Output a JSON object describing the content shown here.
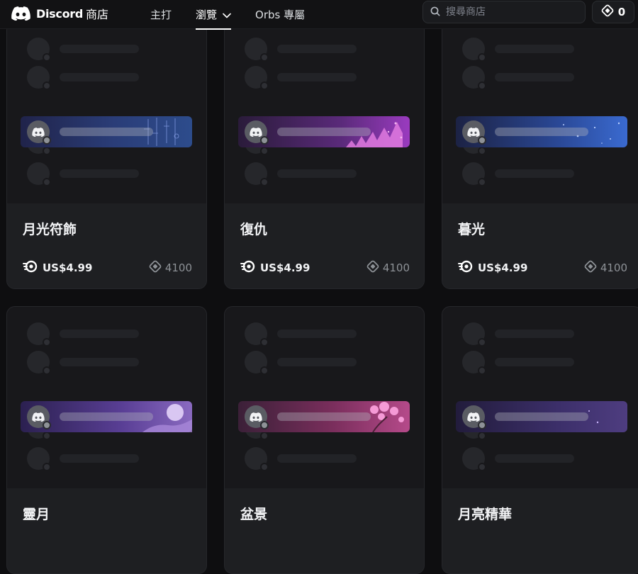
{
  "header": {
    "brand_name": "Discord",
    "brand_suffix": "商店",
    "nav": [
      {
        "label": "主打"
      },
      {
        "label": "瀏覽"
      },
      {
        "label": "Orbs 專屬"
      }
    ],
    "search_placeholder": "搜尋商店",
    "orbs_balance": "0"
  },
  "products": [
    {
      "name": "月光符飾",
      "price": "US$4.99",
      "orbs": "4100",
      "theme": "moon"
    },
    {
      "name": "復仇",
      "price": "US$4.99",
      "orbs": "4100",
      "theme": "revenge"
    },
    {
      "name": "暮光",
      "price": "US$4.99",
      "orbs": "4100",
      "theme": "dusk"
    },
    {
      "name": "靈月",
      "price": "",
      "orbs": "",
      "theme": "spirit"
    },
    {
      "name": "盆景",
      "price": "",
      "orbs": "",
      "theme": "bonsai"
    },
    {
      "name": "月亮精華",
      "price": "",
      "orbs": "",
      "theme": "lunar"
    }
  ],
  "colors": {
    "background": "#0e0e10",
    "card": "#1e1f22",
    "preview": "#18181b",
    "muted_text": "#8e9297"
  }
}
